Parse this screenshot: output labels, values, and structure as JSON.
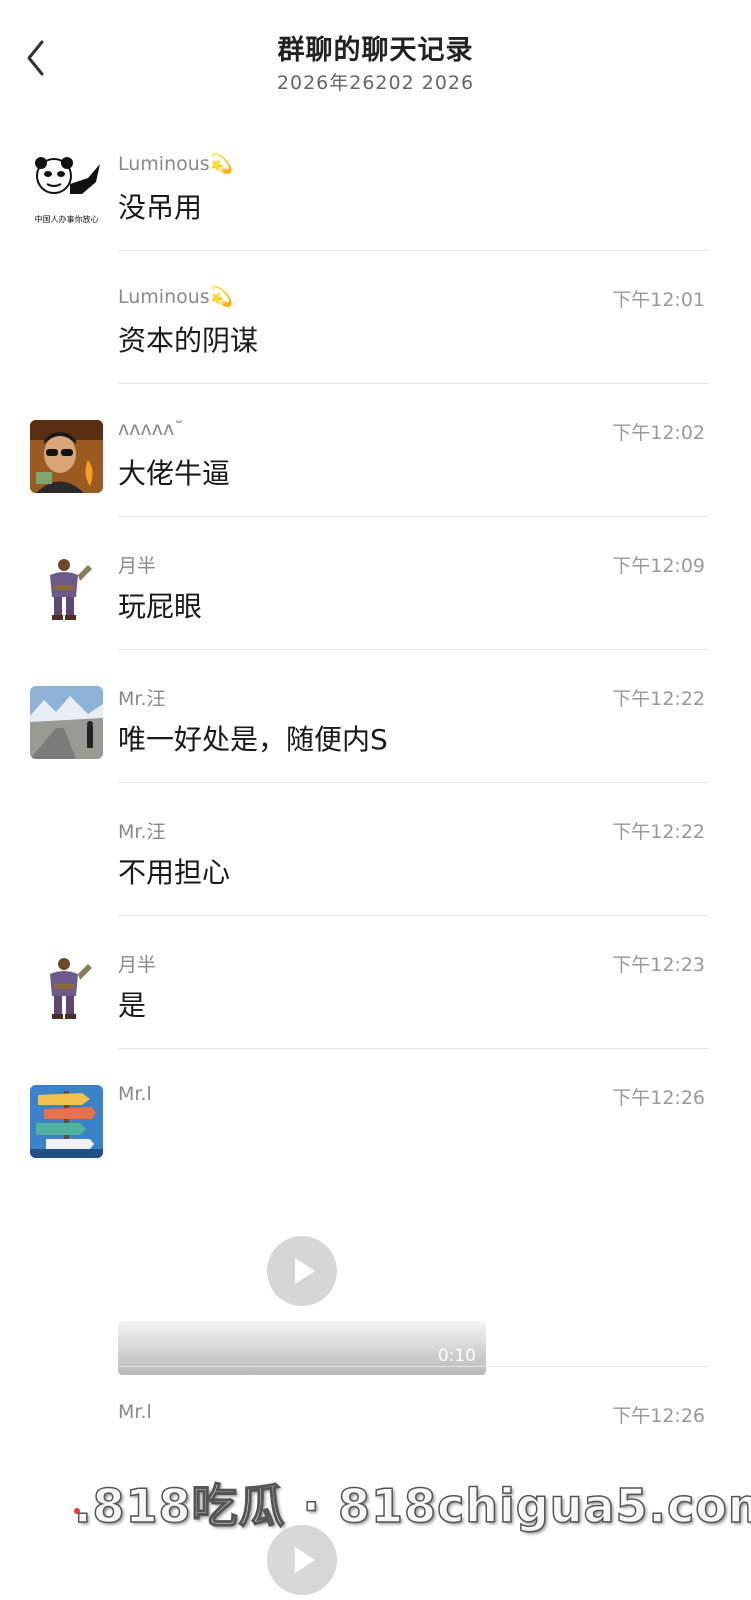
{
  "header": {
    "title": "群聊的聊天记录",
    "subtitle": "2026年26202    2026"
  },
  "messages": [
    {
      "sender": "Luminous💫",
      "time": "",
      "text": "没吊用",
      "avatar": "panda-meme-avatar",
      "avatar_caption": "中国人办事你放心"
    },
    {
      "sender": "Luminous💫",
      "time": "下午12:01",
      "text": "资本的阴谋",
      "avatar": ""
    },
    {
      "sender": "ʌʌʌʌʌ˘",
      "time": "下午12:02",
      "text": "大佬牛逼",
      "avatar": "sunglasses-man-avatar"
    },
    {
      "sender": "月半",
      "time": "下午12:09",
      "text": "玩屁眼",
      "avatar": "game-character-avatar"
    },
    {
      "sender": "Mr.汪",
      "time": "下午12:22",
      "text": "唯一好处是，随便内S",
      "avatar": "mountain-road-avatar"
    },
    {
      "sender": "Mr.汪",
      "time": "下午12:22",
      "text": "不用担心",
      "avatar": ""
    },
    {
      "sender": "月半",
      "time": "下午12:23",
      "text": "是",
      "avatar": "game-character-avatar"
    },
    {
      "sender": "Mr.l",
      "time": "下午12:26",
      "video_duration": "0:10",
      "avatar": "signpost-avatar"
    },
    {
      "sender": "Mr.l",
      "time": "下午12:26"
    }
  ],
  "watermark": ".818吃瓜 · 818chigua5.com"
}
